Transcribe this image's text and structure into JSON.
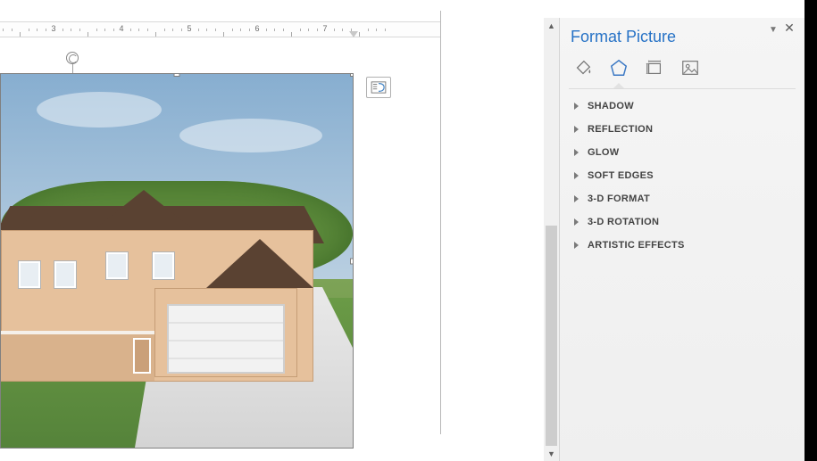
{
  "pane": {
    "title": "Format Picture",
    "tabs": {
      "fill": "fill-line-icon",
      "effects": "effects-icon",
      "size": "size-properties-icon",
      "picture": "picture-icon",
      "selected": "effects"
    },
    "sections": [
      {
        "label": "SHADOW"
      },
      {
        "label": "REFLECTION"
      },
      {
        "label": "GLOW"
      },
      {
        "label": "SOFT EDGES"
      },
      {
        "label": "3-D FORMAT"
      },
      {
        "label": "3-D ROTATION"
      },
      {
        "label": "ARTISTIC EFFECTS"
      }
    ]
  },
  "ruler": {
    "numbers": [
      "3",
      "4",
      "5",
      "6",
      "7"
    ],
    "unitPx": 76
  },
  "colors": {
    "accent": "#2672c6",
    "panelBg": "#f2f2f2",
    "border": "#d4d4d4"
  }
}
